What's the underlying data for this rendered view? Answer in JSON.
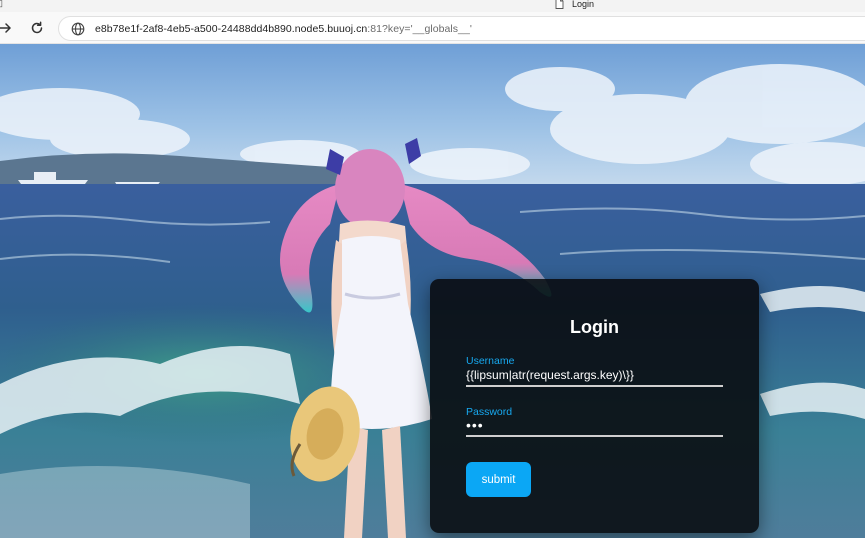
{
  "browser": {
    "tab": {
      "title": "Login"
    },
    "address_bar": {
      "host": "e8b78e1f-2af8-4eb5-a500-24488dd4b890.node5.buuoj.cn",
      "rest": ":81?key='__globals__'"
    }
  },
  "login": {
    "title": "Login",
    "username_label": "Username",
    "username_value": "{{lipsum|atr(request.args.key)\\}}",
    "password_label": "Password",
    "password_value": "•••",
    "submit_label": "submit"
  },
  "colors": {
    "accent": "#0ba7f5",
    "label": "#17a9f0",
    "card_bg": "#080a0e"
  },
  "icons": [
    "page-icon",
    "forward-arrow-icon",
    "reload-icon",
    "globe-icon"
  ]
}
